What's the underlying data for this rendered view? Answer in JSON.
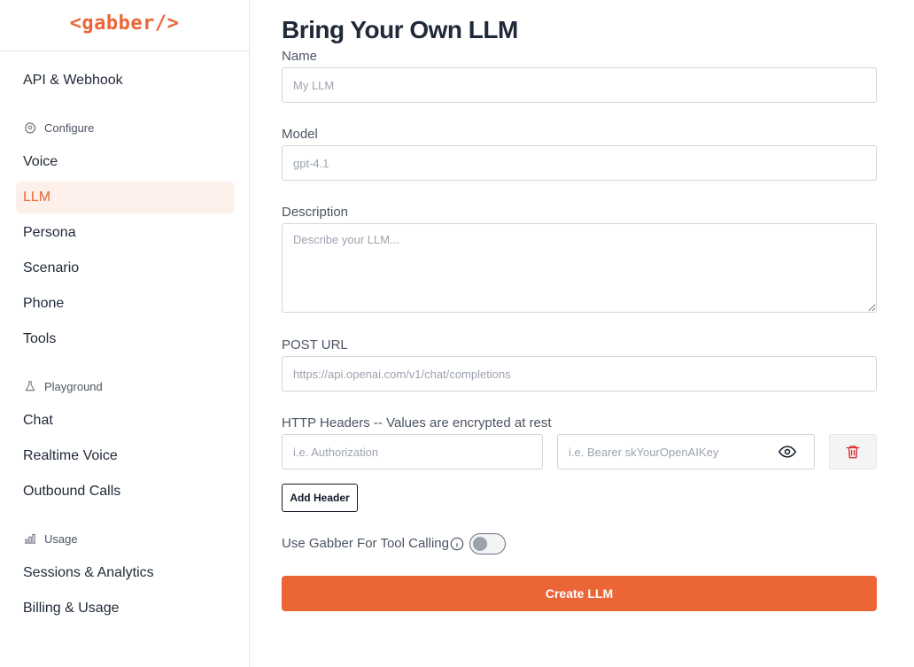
{
  "brand": {
    "logo": "<gabber/>",
    "accent_color": "#ec6536"
  },
  "sidebar": {
    "top_items": [
      {
        "label": "API & Webhook"
      }
    ],
    "sections": [
      {
        "label": "Configure",
        "icon": "gear-icon",
        "items": [
          {
            "label": "Voice"
          },
          {
            "label": "LLM",
            "active": true
          },
          {
            "label": "Persona"
          },
          {
            "label": "Scenario"
          },
          {
            "label": "Phone"
          },
          {
            "label": "Tools"
          }
        ]
      },
      {
        "label": "Playground",
        "icon": "flask-icon",
        "items": [
          {
            "label": "Chat"
          },
          {
            "label": "Realtime Voice"
          },
          {
            "label": "Outbound Calls"
          }
        ]
      },
      {
        "label": "Usage",
        "icon": "bar-chart-icon",
        "items": [
          {
            "label": "Sessions & Analytics"
          },
          {
            "label": "Billing & Usage"
          }
        ]
      }
    ]
  },
  "main": {
    "title": "Bring Your Own LLM",
    "fields": {
      "name": {
        "label": "Name",
        "value": "",
        "placeholder": "My LLM"
      },
      "model": {
        "label": "Model",
        "value": "",
        "placeholder": "gpt-4.1"
      },
      "description": {
        "label": "Description",
        "value": "",
        "placeholder": "Describe your LLM..."
      },
      "post_url": {
        "label": "POST URL",
        "value": "",
        "placeholder": "https://api.openai.com/v1/chat/completions"
      }
    },
    "headers": {
      "label": "HTTP Headers -- Values are encrypted at rest",
      "key_placeholder": "i.e. Authorization",
      "value_placeholder": "i.e. Bearer skYourOpenAIKey",
      "add_label": "Add Header"
    },
    "tool_calling": {
      "label": "Use Gabber For Tool Calling",
      "enabled": false
    },
    "submit_label": "Create LLM"
  }
}
